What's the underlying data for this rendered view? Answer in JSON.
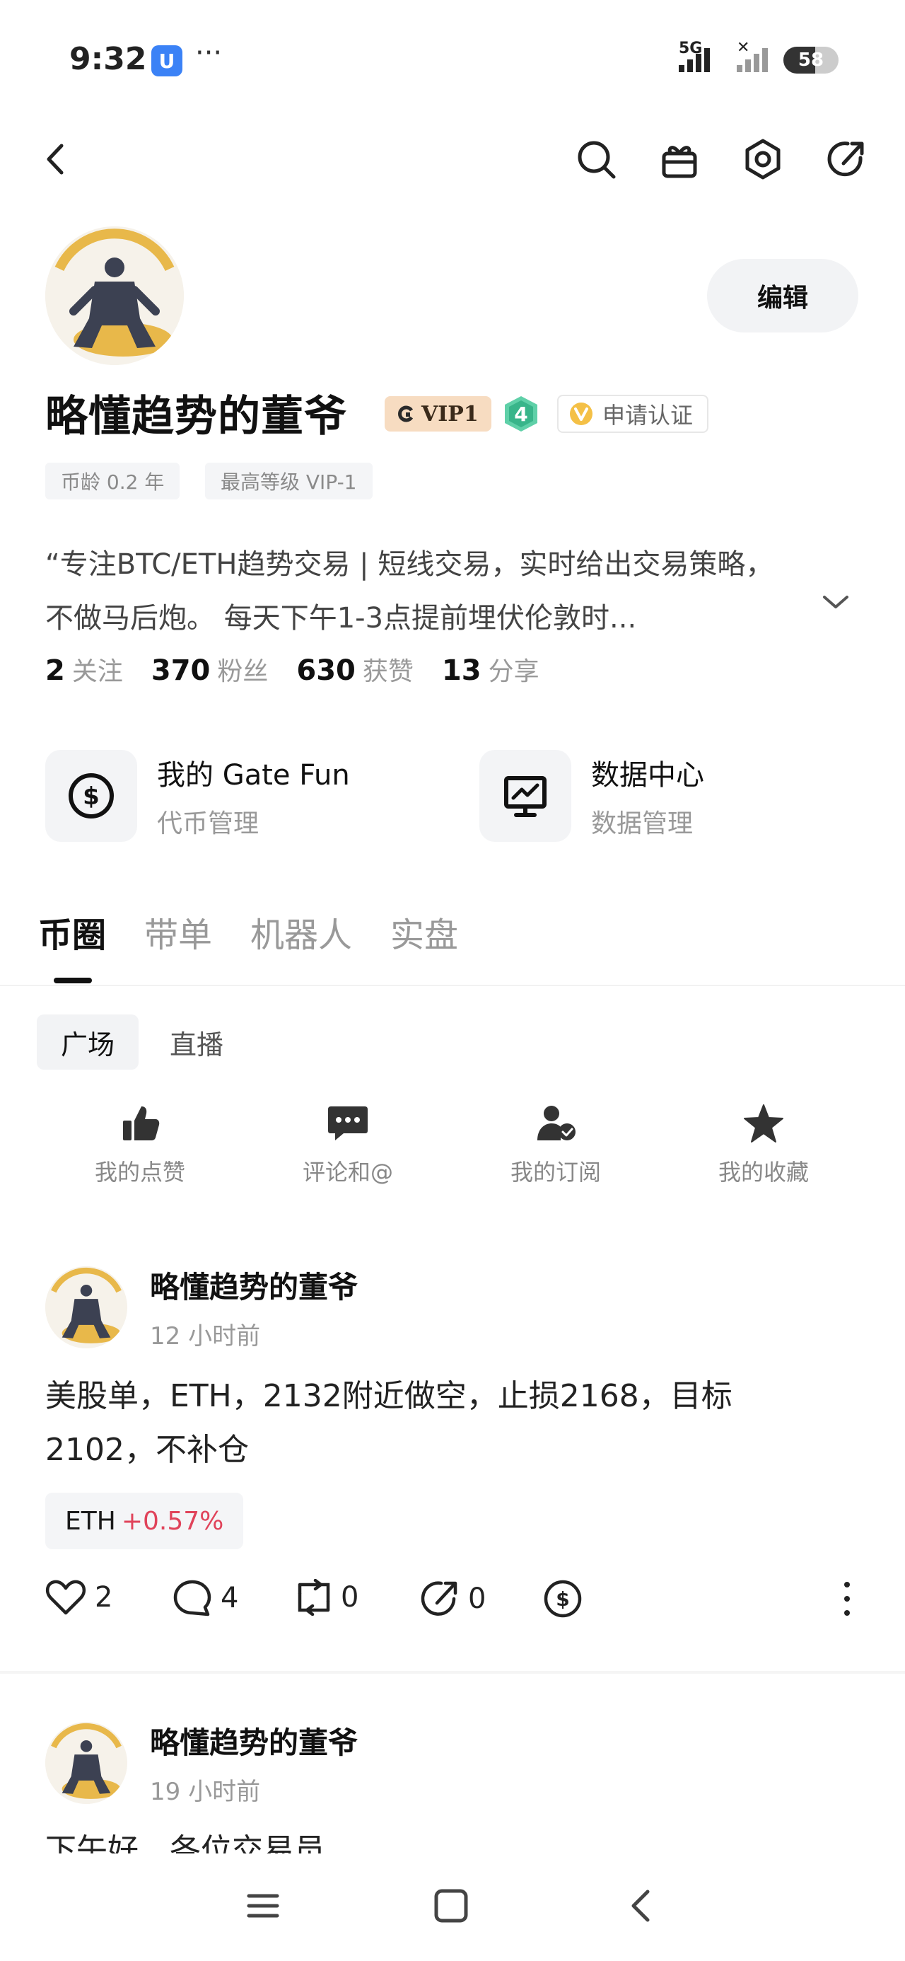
{
  "status_bar": {
    "time": "9:32",
    "app_icon_text": "U",
    "more": "···",
    "network": "5G",
    "battery": "58",
    "battery_level": 0.58
  },
  "profile": {
    "username": "略懂趋势的董爷",
    "vip": "VIP1",
    "level": "4",
    "apply_cert": "申请认证",
    "edit": "编辑",
    "tags": [
      "币龄 0.2 年",
      "最高等级 VIP-1"
    ],
    "bio_line1": "“专注BTC/ETH趋势交易 | 短线交易，实时给出交易策略，",
    "bio_line2": "不做马后炮。 每天下午1-3点提前埋伏伦敦时...",
    "stats": [
      {
        "num": "2",
        "label": "关注"
      },
      {
        "num": "370",
        "label": "粉丝"
      },
      {
        "num": "630",
        "label": "获赞"
      },
      {
        "num": "13",
        "label": "分享"
      }
    ]
  },
  "shortcuts": [
    {
      "title": "我的 Gate Fun",
      "subtitle": "代币管理",
      "icon": "dollar-circle-icon"
    },
    {
      "title": "数据中心",
      "subtitle": "数据管理",
      "icon": "chart-monitor-icon"
    }
  ],
  "tabs": [
    "币圈",
    "带单",
    "机器人",
    "实盘"
  ],
  "subtabs": [
    "广场",
    "直播"
  ],
  "quick_actions": [
    {
      "label": "我的点赞",
      "icon": "thumbs-up-icon"
    },
    {
      "label": "评论和@",
      "icon": "comment-icon"
    },
    {
      "label": "我的订阅",
      "icon": "user-check-icon"
    },
    {
      "label": "我的收藏",
      "icon": "star-icon"
    }
  ],
  "posts": [
    {
      "author": "略懂趋势的董爷",
      "time": "12 小时前",
      "text_line1": "美股单，ETH，2132附近做空，止损2168，目标",
      "text_line2": "2102，不补仓",
      "coin": "ETH",
      "coin_change": "+0.57%",
      "likes": "2",
      "comments": "4",
      "reposts": "0",
      "shares": "0"
    },
    {
      "author": "略懂趋势的董爷",
      "time": "19 小时前",
      "text_line1": "下午好，各位交易员"
    }
  ]
}
